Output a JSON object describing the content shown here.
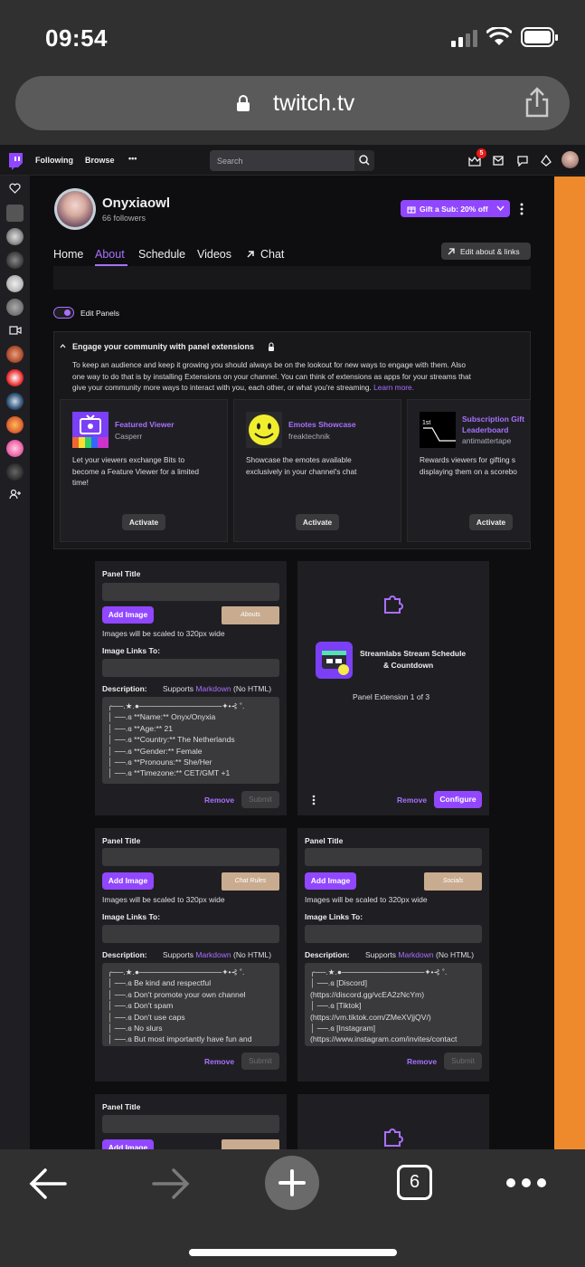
{
  "status": {
    "time": "09:54"
  },
  "browser": {
    "domain": "twitch.tv",
    "tab_count": "6"
  },
  "nav": {
    "following": "Following",
    "browse": "Browse",
    "more": "•••",
    "search_placeholder": "Search",
    "notif_count": "5"
  },
  "channel": {
    "name": "Onyxiaowl",
    "followers": "66 followers",
    "gift_label": "Gift a Sub: 20% off"
  },
  "tabs": [
    {
      "label": "Home",
      "active": false
    },
    {
      "label": "About",
      "active": true
    },
    {
      "label": "Schedule",
      "active": false
    },
    {
      "label": "Videos",
      "active": false
    },
    {
      "label": "Chat",
      "active": false
    }
  ],
  "edit_about": "Edit about & links",
  "edit_panels": "Edit Panels",
  "engage": {
    "title": "Engage your community with panel extensions",
    "body1": "To keep an audience and keep it growing you should always be on the lookout for new ways to engage with them. Also",
    "body2": "one way to do that is by installing Extensions on your channel. You can think of extensions as apps for your streams that",
    "body3": "give your community more ways to interact with you, each other, or what you're streaming.",
    "learn_more": "Learn more.",
    "extensions": [
      {
        "name": "Featured Viewer",
        "author": "Casperr",
        "desc1": "Let your viewers exchange Bits to",
        "desc2": "become a Feature Viewer for a limited",
        "desc3": "time!",
        "button": "Activate"
      },
      {
        "name": "Emotes Showcase",
        "author": "freaktechnik",
        "desc1": "Showcase the emotes available",
        "desc2": "exclusively in your channel's chat",
        "desc3": "",
        "button": "Activate"
      },
      {
        "name1": "Subscription Gift",
        "name2": "Leaderboard",
        "author": "antimattertape",
        "desc1": "Rewards viewers for gifting s",
        "desc2": "displaying them on a scorebo",
        "button": "Activate"
      }
    ]
  },
  "panel_common": {
    "title_label": "Panel Title",
    "add_image": "Add Image",
    "scale_note": "Images will be scaled to 320px wide",
    "links_label": "Image Links To:",
    "desc_label": "Description:",
    "supports": "Supports",
    "markdown": "Markdown",
    "no_html": "(No HTML)",
    "remove": "Remove",
    "submit": "Submit"
  },
  "panel1": {
    "thumb": "Abouts",
    "desc": "╭──.★.●───────────────✦•⊰ ˚.\n│ ──.ɞ **Name:** Onyx/Onyxia\n│ ──.ɞ **Age:** 21\n│ ──.ɞ **Country:** The Netherlands\n│ ──.ɞ **Gender:** Female\n│ ──.ɞ **Pronouns:** She/Her\n│ ──.ɞ **Timezone:** CET/GMT +1"
  },
  "extension_panel": {
    "name1": "Streamlabs Stream Schedule",
    "name2": "& Countdown",
    "caption": "Panel Extension 1 of 3",
    "remove": "Remove",
    "configure": "Configure"
  },
  "panel3": {
    "thumb": "Chat Rules",
    "desc": "╭──.★.●───────────────✦•⊰ ˚.\n│ ──.ɞ Be kind and respectful\n│ ──.ɞ Don't promote your own channel\n│ ──.ɞ Don't spam\n│ ──.ɞ Don't use caps\n│ ──.ɞ No slurs\n│ ──.ɞ But most importantly have fun and"
  },
  "panel4": {
    "thumb": "Socials",
    "desc": "╭──.★.●───────────────✦•⊰ ˚.\n│ ──.ɞ [Discord]\n(https://discord.gg/vcEA2zNcYm)\n│ ──.ɞ [Tiktok]\n(https://vm.tiktok.com/ZMeXVjjQV/)\n│ ──.ɞ [Instagram]\n(https://www.instagram.com/invites/contact"
  },
  "colors": {
    "accent": "#9147ff",
    "orange": "#ee8a2c"
  }
}
